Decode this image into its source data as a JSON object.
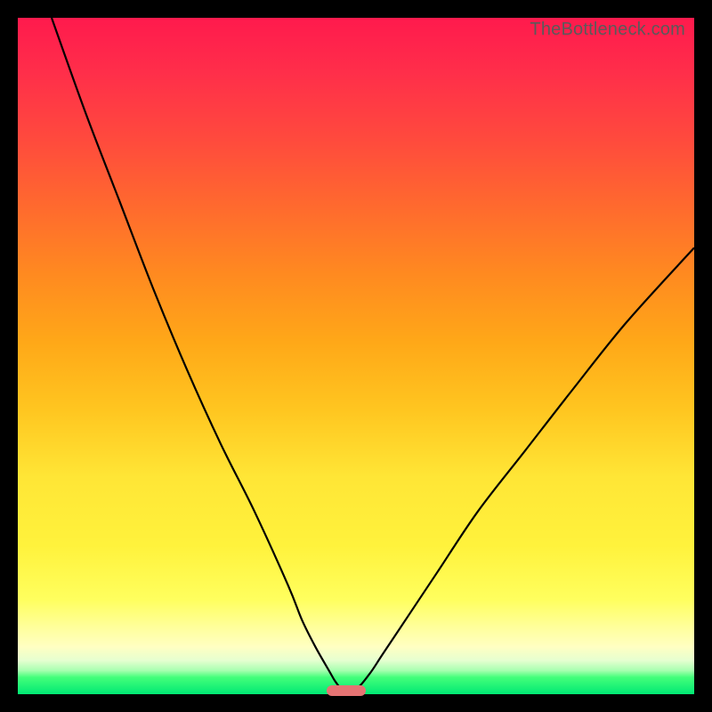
{
  "watermark": "TheBottleneck.com",
  "chart_data": {
    "type": "line",
    "title": "",
    "xlabel": "",
    "ylabel": "",
    "xlim": [
      0,
      100
    ],
    "ylim": [
      0,
      100
    ],
    "series": [
      {
        "name": "curve",
        "x": [
          5,
          10,
          15,
          20,
          25,
          30,
          35,
          40,
          42,
          44,
          46,
          47,
          48,
          50,
          52,
          54,
          58,
          62,
          68,
          75,
          82,
          90,
          100
        ],
        "y": [
          100,
          86,
          73,
          60,
          48,
          37,
          27,
          16,
          11,
          7,
          3.5,
          1.8,
          0.8,
          0.8,
          3,
          6,
          12,
          18,
          27,
          36,
          45,
          55,
          66
        ]
      }
    ],
    "marker": {
      "x": 48.5,
      "y": 0.5
    },
    "colors": {
      "curve": "#000000",
      "marker_fill": "#e57373",
      "gradient_top": "#ff1a4d",
      "gradient_bottom": "#00e874"
    }
  }
}
